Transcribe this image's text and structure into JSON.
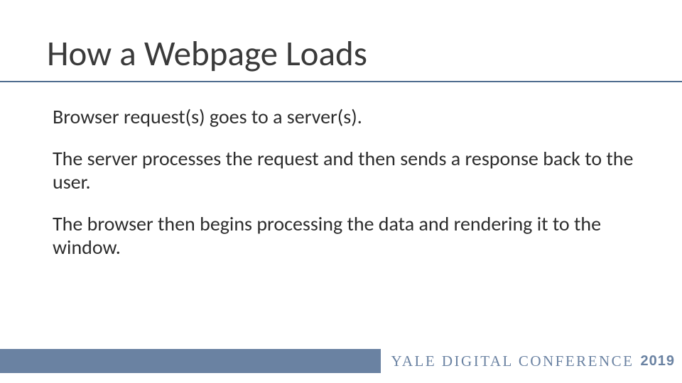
{
  "slide": {
    "title": "How a Webpage Loads",
    "paragraphs": [
      "Browser request(s) goes to a server(s).",
      "The server processes the request and then sends a response back to the user.",
      "The browser then begins processing the data and rendering it to the window."
    ]
  },
  "footer": {
    "brand": "YALE DIGITAL CONFERENCE",
    "year": "2019"
  },
  "colors": {
    "accent": "#6a82a2",
    "rule": "#4f6d8f",
    "text": "#2d2d2d"
  }
}
